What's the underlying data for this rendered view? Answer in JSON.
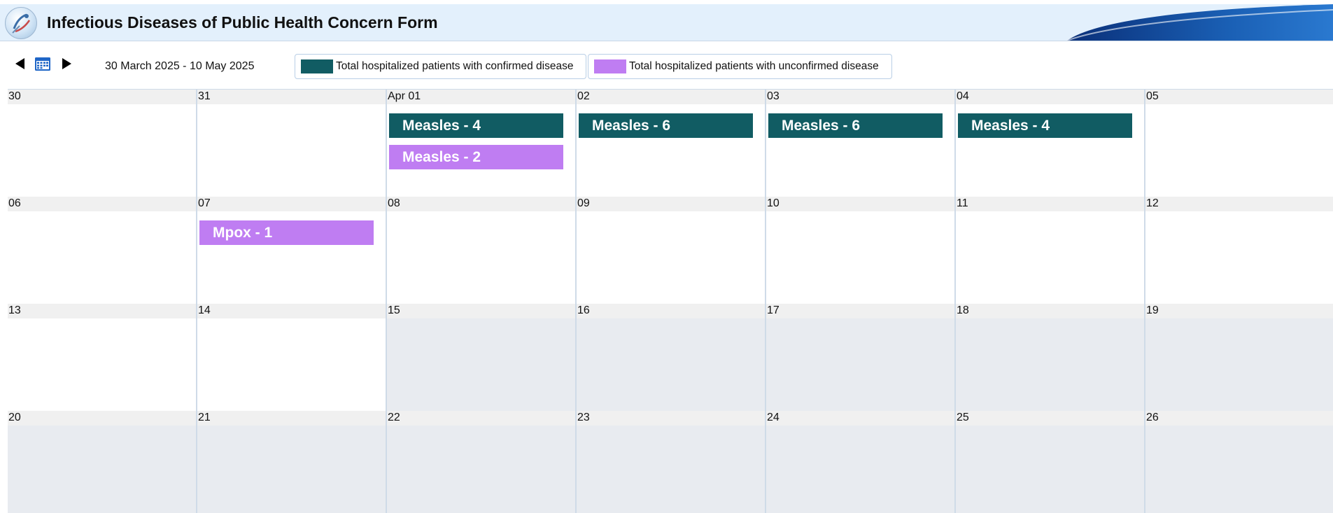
{
  "header": {
    "title": "Infectious Diseases of Public Health Concern Form"
  },
  "toolbar": {
    "date_range": "30 March 2025  -  10 May 2025"
  },
  "legend": [
    {
      "label": "Total hospitalized patients with confirmed disease",
      "color": "#115c63"
    },
    {
      "label": "Total hospitalized patients with unconfirmed disease",
      "color": "#bf7df2"
    }
  ],
  "calendar": {
    "weeks": [
      {
        "days": [
          "30",
          "31",
          "Apr 01",
          "02",
          "03",
          "04",
          "05"
        ]
      },
      {
        "days": [
          "06",
          "07",
          "08",
          "09",
          "10",
          "11",
          "12"
        ]
      },
      {
        "days": [
          "13",
          "14",
          "15",
          "16",
          "17",
          "18",
          "19"
        ]
      },
      {
        "days": [
          "20",
          "21",
          "22",
          "23",
          "24",
          "25",
          "26"
        ]
      }
    ],
    "events": [
      {
        "week": 0,
        "day": 2,
        "slot": 0,
        "label": "Measles - 4",
        "type": "confirmed"
      },
      {
        "week": 0,
        "day": 2,
        "slot": 1,
        "label": "Measles - 2",
        "type": "unconfirmed"
      },
      {
        "week": 0,
        "day": 3,
        "slot": 0,
        "label": "Measles - 6",
        "type": "confirmed"
      },
      {
        "week": 0,
        "day": 4,
        "slot": 0,
        "label": "Measles - 6",
        "type": "confirmed"
      },
      {
        "week": 0,
        "day": 5,
        "slot": 0,
        "label": "Measles - 4",
        "type": "confirmed"
      },
      {
        "week": 1,
        "day": 1,
        "slot": 0,
        "label": "Mpox - 1",
        "type": "unconfirmed"
      }
    ]
  },
  "colors": {
    "confirmed": "#115c63",
    "unconfirmed": "#bf7df2",
    "past_day": "#ffffff",
    "future_day": "#e8ebf0"
  }
}
